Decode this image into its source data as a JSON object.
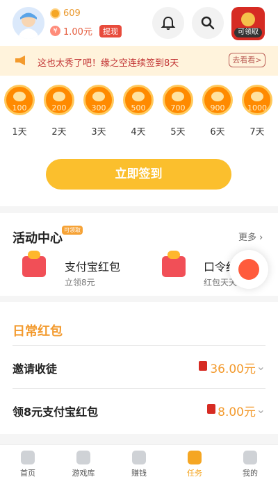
{
  "header": {
    "coin_count": "609",
    "money": "1.00元",
    "withdraw_label": "提现",
    "redpacket_label": "可领取"
  },
  "banner": {
    "text": "这也太秀了吧！缘之空连续签到8天",
    "button": "去看看>"
  },
  "checkin": {
    "days": [
      {
        "amount": "100",
        "label": "1天"
      },
      {
        "amount": "200",
        "label": "2天"
      },
      {
        "amount": "300",
        "label": "3天"
      },
      {
        "amount": "500",
        "label": "4天"
      },
      {
        "amount": "700",
        "label": "5天"
      },
      {
        "amount": "900",
        "label": "6天"
      },
      {
        "amount": "1000",
        "label": "7天"
      }
    ],
    "button": "立即签到"
  },
  "activity": {
    "title": "活动中心",
    "tag": "可领取",
    "more": "更多",
    "items": [
      {
        "title": "支付宝红包",
        "sub": "立领8元"
      },
      {
        "title": "口令红包",
        "sub": "红包天天"
      }
    ]
  },
  "daily": {
    "title": "日常红包",
    "rows": [
      {
        "title": "邀请收徒",
        "value": "36.00元"
      },
      {
        "title": "领8元支付宝红包",
        "value": "8.00元"
      }
    ]
  },
  "tabs": [
    {
      "label": "首页"
    },
    {
      "label": "游戏库"
    },
    {
      "label": "赚钱"
    },
    {
      "label": "任务"
    },
    {
      "label": "我的"
    }
  ]
}
